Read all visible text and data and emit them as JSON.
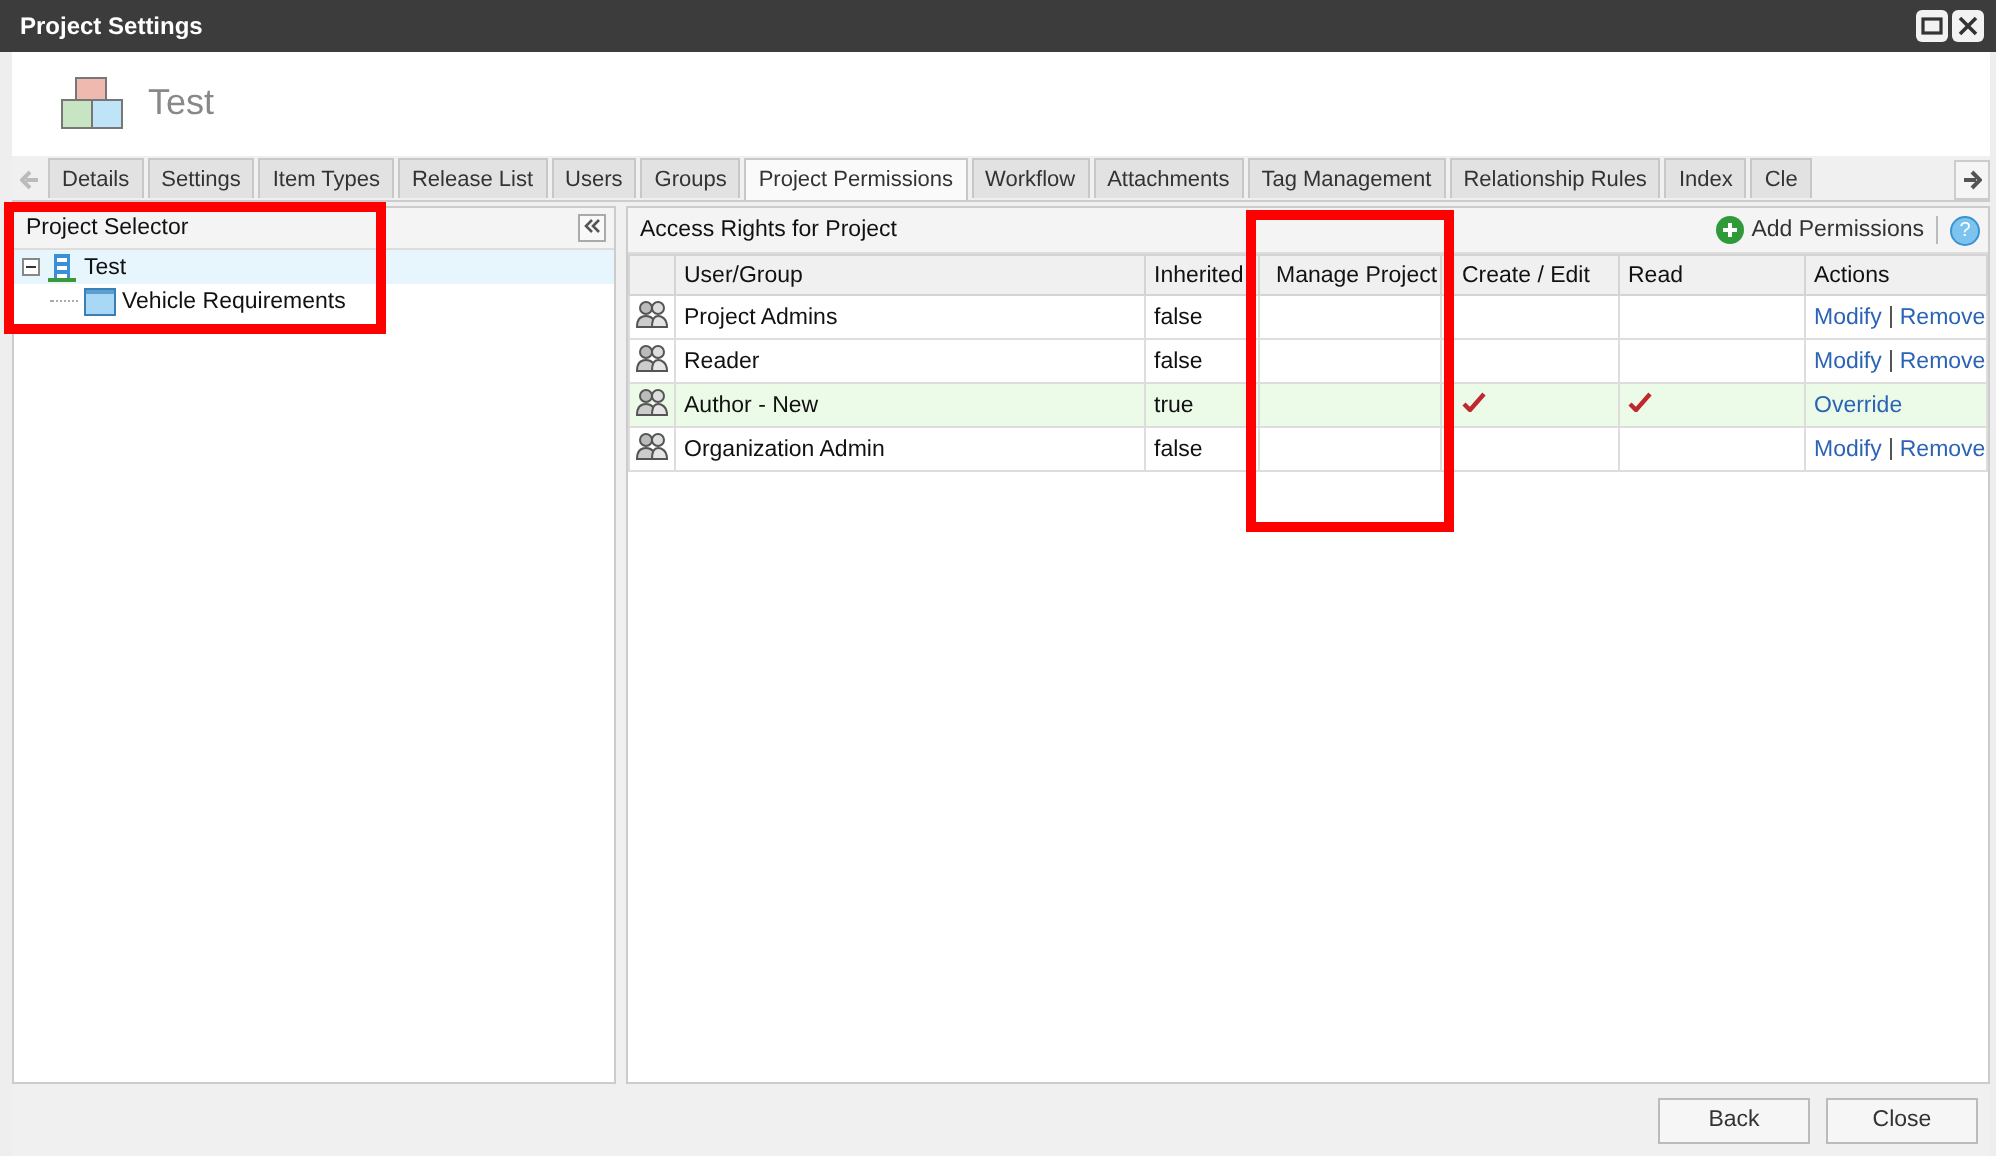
{
  "window": {
    "title": "Project Settings"
  },
  "project": {
    "name": "Test"
  },
  "tabs": [
    {
      "label": "Details",
      "selected": false
    },
    {
      "label": "Settings",
      "selected": false
    },
    {
      "label": "Item Types",
      "selected": false
    },
    {
      "label": "Release List",
      "selected": false
    },
    {
      "label": "Users",
      "selected": false
    },
    {
      "label": "Groups",
      "selected": false
    },
    {
      "label": "Project Permissions",
      "selected": true
    },
    {
      "label": "Workflow",
      "selected": false
    },
    {
      "label": "Attachments",
      "selected": false
    },
    {
      "label": "Tag Management",
      "selected": false
    },
    {
      "label": "Relationship Rules",
      "selected": false
    },
    {
      "label": "Index",
      "selected": false
    },
    {
      "label": "Cle",
      "selected": false
    }
  ],
  "sidebar": {
    "title": "Project Selector",
    "tree": [
      {
        "label": "Test",
        "kind": "project",
        "selected": true,
        "expanded": true,
        "children": [
          {
            "label": "Vehicle Requirements",
            "kind": "folder",
            "selected": false
          }
        ]
      }
    ]
  },
  "panel": {
    "title": "Access Rights for Project",
    "add_button": "Add Permissions",
    "help": "?"
  },
  "table": {
    "columns": [
      "User/Group",
      "Inherited",
      "Manage Project",
      "Create / Edit",
      "Read",
      "Actions"
    ],
    "rows": [
      {
        "name": "Project Admins",
        "inherited": "false",
        "manage": false,
        "create": false,
        "read": false,
        "selected": false,
        "actions": [
          "Modify",
          "Remove"
        ]
      },
      {
        "name": "Reader",
        "inherited": "false",
        "manage": false,
        "create": false,
        "read": false,
        "selected": false,
        "actions": [
          "Modify",
          "Remove"
        ]
      },
      {
        "name": "Author - New",
        "inherited": "true",
        "manage": false,
        "create": true,
        "read": true,
        "selected": true,
        "actions": [
          "Override"
        ]
      },
      {
        "name": "Organization Admin",
        "inherited": "false",
        "manage": false,
        "create": false,
        "read": false,
        "selected": false,
        "actions": [
          "Modify",
          "Remove"
        ]
      }
    ]
  },
  "buttons": [
    "Back",
    "Close"
  ]
}
